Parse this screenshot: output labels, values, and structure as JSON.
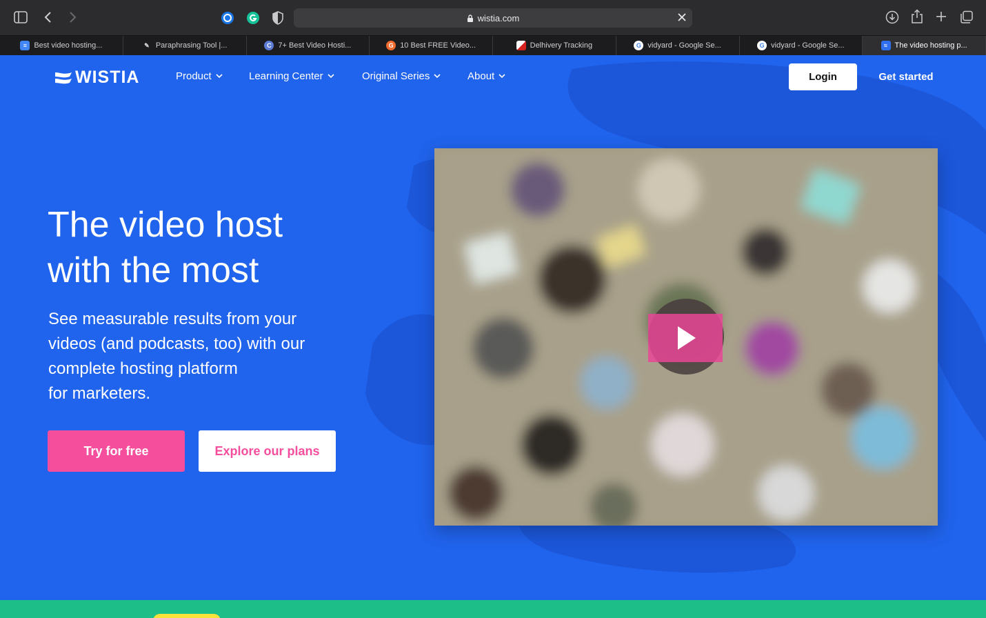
{
  "browser": {
    "url": "wistia.com",
    "tabs": [
      {
        "label": "Best video hosting...",
        "favicon": "docs-icon"
      },
      {
        "label": "Paraphrasing Tool |...",
        "favicon": "quill-icon"
      },
      {
        "label": "7+ Best Video Hosti...",
        "favicon": "c-icon"
      },
      {
        "label": "10 Best FREE Video...",
        "favicon": "g-orange-icon"
      },
      {
        "label": "Delhivery Tracking",
        "favicon": "delhivery-icon"
      },
      {
        "label": "vidyard - Google Se...",
        "favicon": "google-icon"
      },
      {
        "label": "vidyard - Google Se...",
        "favicon": "google-icon"
      },
      {
        "label": "The video hosting p...",
        "favicon": "wistia-icon",
        "active": true
      }
    ]
  },
  "site": {
    "logo_text": "WISTIA",
    "nav": [
      "Product",
      "Learning Center",
      "Original Series",
      "About"
    ],
    "login_label": "Login",
    "get_started_label": "Get started"
  },
  "hero": {
    "title_line1": "The video host",
    "title_line2": "with the most",
    "subtitle_lines": [
      "See measurable results from your",
      "videos (and podcasts, too) with our",
      "complete hosting platform",
      "for marketers."
    ],
    "try_label": "Try for free",
    "plans_label": "Explore our plans"
  },
  "colors": {
    "brand_blue": "#2063ec",
    "accent_pink": "#f54e9d",
    "green": "#1dbe87"
  }
}
